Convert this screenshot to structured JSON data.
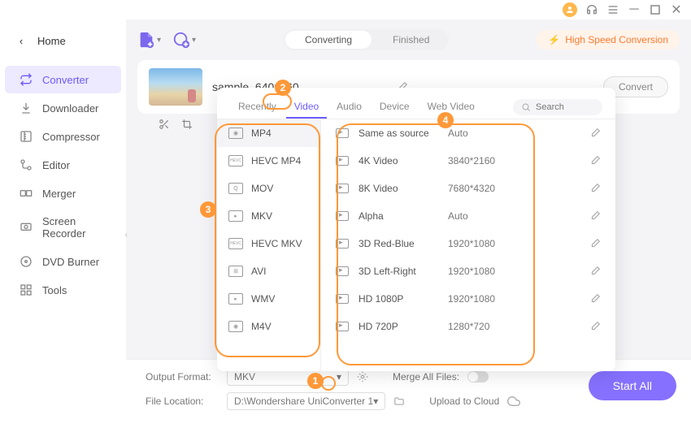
{
  "titlebar": {
    "avatar": "user"
  },
  "sidebar": {
    "home": "Home",
    "items": [
      {
        "label": "Converter",
        "icon": "convert"
      },
      {
        "label": "Downloader",
        "icon": "download"
      },
      {
        "label": "Compressor",
        "icon": "compress"
      },
      {
        "label": "Editor",
        "icon": "edit"
      },
      {
        "label": "Merger",
        "icon": "merge"
      },
      {
        "label": "Screen Recorder",
        "icon": "record"
      },
      {
        "label": "DVD Burner",
        "icon": "dvd"
      },
      {
        "label": "Tools",
        "icon": "tools"
      }
    ]
  },
  "toolbar": {
    "segments": {
      "converting": "Converting",
      "finished": "Finished"
    },
    "high_speed": "High Speed Conversion"
  },
  "file": {
    "name": "sample_640x360",
    "convert_btn": "Convert"
  },
  "dropdown": {
    "tabs": {
      "recently": "Recently",
      "video": "Video",
      "audio": "Audio",
      "device": "Device",
      "web": "Web Video"
    },
    "search_placeholder": "Search",
    "formats": [
      "MP4",
      "HEVC MP4",
      "MOV",
      "MKV",
      "HEVC MKV",
      "AVI",
      "WMV",
      "M4V"
    ],
    "resolutions": [
      {
        "name": "Same as source",
        "value": "Auto"
      },
      {
        "name": "4K Video",
        "value": "3840*2160"
      },
      {
        "name": "8K Video",
        "value": "7680*4320"
      },
      {
        "name": "Alpha",
        "value": "Auto"
      },
      {
        "name": "3D Red-Blue",
        "value": "1920*1080"
      },
      {
        "name": "3D Left-Right",
        "value": "1920*1080"
      },
      {
        "name": "HD 1080P",
        "value": "1920*1080"
      },
      {
        "name": "HD 720P",
        "value": "1280*720"
      }
    ]
  },
  "footer": {
    "output_format_label": "Output Format:",
    "output_format_value": "MKV",
    "file_location_label": "File Location:",
    "file_location_value": "D:\\Wondershare UniConverter 1",
    "merge_label": "Merge All Files:",
    "upload_label": "Upload to Cloud",
    "start": "Start All"
  },
  "steps": {
    "s1": "1",
    "s2": "2",
    "s3": "3",
    "s4": "4"
  }
}
